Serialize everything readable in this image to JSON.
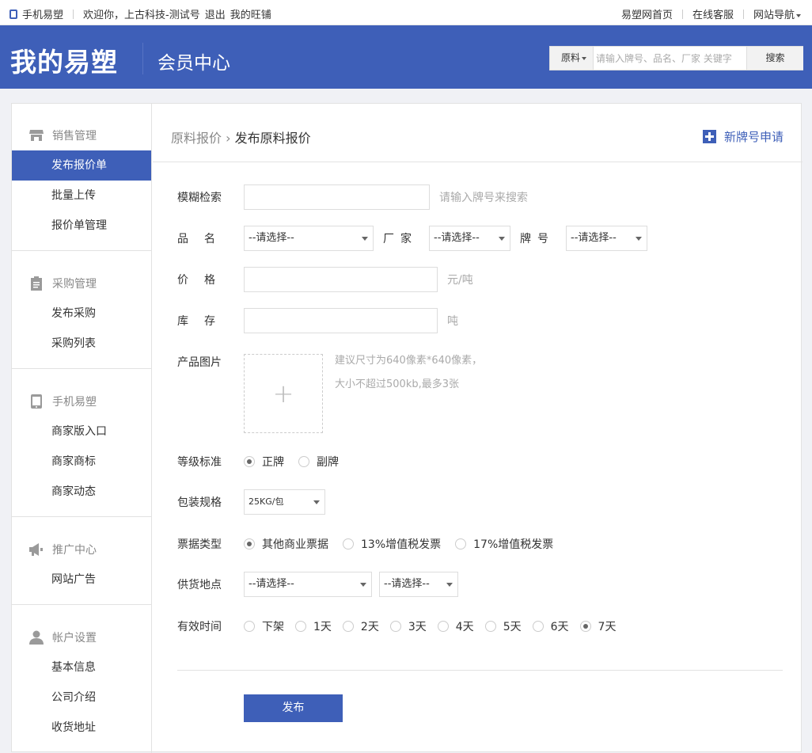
{
  "topbar": {
    "mobile_link": "手机易塑",
    "welcome": "欢迎你，上古科技-测试号",
    "logout": "退出",
    "my_shop": "我的旺铺",
    "home_link": "易塑网首页",
    "service_link": "在线客服",
    "nav_link": "网站导航"
  },
  "header": {
    "logo": "我的易塑",
    "title": "会员中心",
    "search": {
      "category": "原料",
      "placeholder": "请输入牌号、品名、厂家 关键字",
      "button": "搜索"
    }
  },
  "sidebar": {
    "groups": [
      {
        "title": "销售管理",
        "icon": "store-icon",
        "items": [
          "发布报价单",
          "批量上传",
          "报价单管理"
        ]
      },
      {
        "title": "采购管理",
        "icon": "clipboard-icon",
        "items": [
          "发布采购",
          "采购列表"
        ]
      },
      {
        "title": "手机易塑",
        "icon": "tablet-icon",
        "items": [
          "商家版入口",
          "商家商标",
          "商家动态"
        ]
      },
      {
        "title": "推广中心",
        "icon": "megaphone-icon",
        "items": [
          "网站广告"
        ]
      },
      {
        "title": "帐户设置",
        "icon": "user-icon",
        "items": [
          "基本信息",
          "公司介绍",
          "收货地址"
        ]
      }
    ]
  },
  "content": {
    "breadcrumb_parent": "原料报价",
    "breadcrumb_sep": "›",
    "breadcrumb_current": "发布原料报价",
    "new_brand": "新牌号申请",
    "form": {
      "fuzzy_label": "模糊检索",
      "fuzzy_hint": "请输入牌号来搜索",
      "name_label": "品名",
      "name_select": "--请选择--",
      "factory_label": "厂家",
      "factory_select": "--请选择--",
      "brand_label": "牌号",
      "brand_select": "--请选择--",
      "price_label": "价格",
      "price_unit": "元/吨",
      "stock_label": "库存",
      "stock_unit": "吨",
      "image_label": "产品图片",
      "image_hint_1": "建议尺寸为640像素*640像素，",
      "image_hint_2": "大小不超过500kb,最多3张",
      "grade_label": "等级标准",
      "grade_options": [
        "正牌",
        "副牌"
      ],
      "grade_selected": 0,
      "package_label": "包装规格",
      "package_select": "25KG/包",
      "invoice_label": "票据类型",
      "invoice_options": [
        "其他商业票据",
        "13%增值税发票",
        "17%增值税发票"
      ],
      "invoice_selected": 0,
      "location_label": "供货地点",
      "location_select_1": "--请选择--",
      "location_select_2": "--请选择--",
      "valid_label": "有效时间",
      "valid_options": [
        "下架",
        "1天",
        "2天",
        "3天",
        "4天",
        "5天",
        "6天",
        "7天"
      ],
      "valid_selected": 7,
      "submit": "发布"
    }
  }
}
